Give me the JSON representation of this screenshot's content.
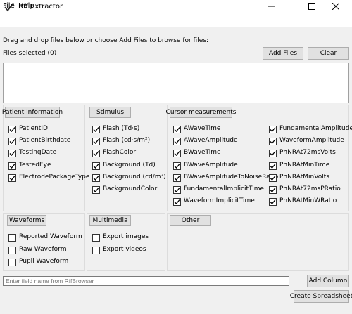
{
  "window": {
    "title": "Rff Extractor",
    "minimize_icon": "minimize-icon",
    "maximize_icon": "maximize-icon",
    "close_icon": "close-icon"
  },
  "menu": [
    "File",
    "Help"
  ],
  "instructions": "Drag and drop files below or choose Add Files to browse for files:",
  "files_selected": "Files selected (0)",
  "buttons": {
    "add_files": "Add Files",
    "clear": "Clear",
    "add_column": "Add Column",
    "create_spreadsheet": "Create Spreadsheet"
  },
  "sections": {
    "patient": {
      "header": "Patient information",
      "items": [
        {
          "label": "PatientID",
          "checked": true
        },
        {
          "label": "PatientBirthdate",
          "checked": true
        },
        {
          "label": "TestingDate",
          "checked": true
        },
        {
          "label": "TestedEye",
          "checked": true
        },
        {
          "label": "ElectrodePackageType",
          "checked": true
        }
      ]
    },
    "stimulus": {
      "header": "Stimulus",
      "items": [
        {
          "label": "Flash (Td·s)",
          "checked": true
        },
        {
          "label": "Flash (cd·s/m²)",
          "checked": true
        },
        {
          "label": "FlashColor",
          "checked": true
        },
        {
          "label": "Background (Td)",
          "checked": true
        },
        {
          "label": "Background (cd/m²)",
          "checked": true
        },
        {
          "label": "BackgroundColor",
          "checked": true
        }
      ]
    },
    "cursor": {
      "header": "Cursor measurements",
      "col1": [
        {
          "label": "AWaveTime",
          "checked": true
        },
        {
          "label": "AWaveAmplitude",
          "checked": true
        },
        {
          "label": "BWaveTime",
          "checked": true
        },
        {
          "label": "BWaveAmplitude",
          "checked": true
        },
        {
          "label": "BWaveAmplitudeToNoiseRatio",
          "checked": true
        },
        {
          "label": "FundamentalImplicitTime",
          "checked": true
        },
        {
          "label": "WaveformImplicitTime",
          "checked": true
        }
      ],
      "col2": [
        {
          "label": "FundamentalAmplitude",
          "checked": true
        },
        {
          "label": "WaveformAmplitude",
          "checked": true
        },
        {
          "label": "PhNRAt72msVolts",
          "checked": true
        },
        {
          "label": "PhNRAtMinTime",
          "checked": true
        },
        {
          "label": "PhNRAtMinVolts",
          "checked": true
        },
        {
          "label": "PhNRAt72msPRatio",
          "checked": true
        },
        {
          "label": "PhNRAtMinWRatio",
          "checked": true
        }
      ]
    },
    "waveforms": {
      "header": "Waveforms",
      "items": [
        {
          "label": "Reported Waveform",
          "checked": false
        },
        {
          "label": "Raw Waveform",
          "checked": false
        },
        {
          "label": "Pupil Waveform",
          "checked": false
        }
      ]
    },
    "multimedia": {
      "header": "Multimedia",
      "items": [
        {
          "label": "Export images",
          "checked": false
        },
        {
          "label": "Export videos",
          "checked": false
        }
      ]
    },
    "other": {
      "header": "Other"
    }
  },
  "field_input": {
    "placeholder": "Enter field name from RffBrowser",
    "value": ""
  }
}
